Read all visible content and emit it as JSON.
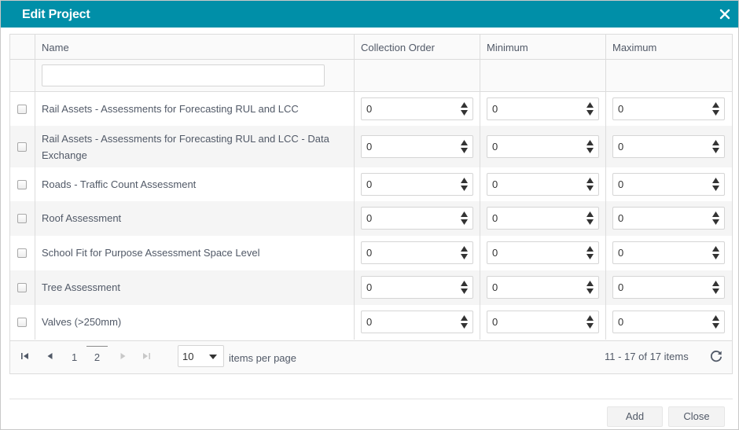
{
  "dialog": {
    "title": "Edit Project"
  },
  "grid": {
    "columns": [
      "Name",
      "Collection Order",
      "Minimum",
      "Maximum"
    ],
    "filter_value": "",
    "rows": [
      {
        "name": "Rail Assets - Assessments for Forecasting RUL and LCC",
        "collection_order": "0",
        "minimum": "0",
        "maximum": "0"
      },
      {
        "name": "Rail Assets - Assessments for Forecasting RUL and LCC - Data Exchange",
        "collection_order": "0",
        "minimum": "0",
        "maximum": "0"
      },
      {
        "name": "Roads - Traffic Count Assessment",
        "collection_order": "0",
        "minimum": "0",
        "maximum": "0"
      },
      {
        "name": "Roof Assessment",
        "collection_order": "0",
        "minimum": "0",
        "maximum": "0"
      },
      {
        "name": "School Fit for Purpose Assessment Space Level",
        "collection_order": "0",
        "minimum": "0",
        "maximum": "0"
      },
      {
        "name": "Tree Assessment",
        "collection_order": "0",
        "minimum": "0",
        "maximum": "0"
      },
      {
        "name": "Valves (>250mm)",
        "collection_order": "0",
        "minimum": "0",
        "maximum": "0"
      }
    ]
  },
  "pager": {
    "pages": [
      "1",
      "2"
    ],
    "current_page": "2",
    "page_size": "10",
    "items_per_page_label": "items per page",
    "info": "11 - 17 of 17 items"
  },
  "footer": {
    "add_label": "Add",
    "close_label": "Close"
  },
  "colors": {
    "titlebar": "#008fa8",
    "row_alt": "#f5f5f5",
    "border": "#dcdcdc"
  },
  "icons": [
    "close-icon",
    "spinner-arrows-icon",
    "first-page-icon",
    "prev-page-icon",
    "next-page-icon",
    "last-page-icon",
    "dropdown-caret-icon",
    "refresh-icon"
  ]
}
